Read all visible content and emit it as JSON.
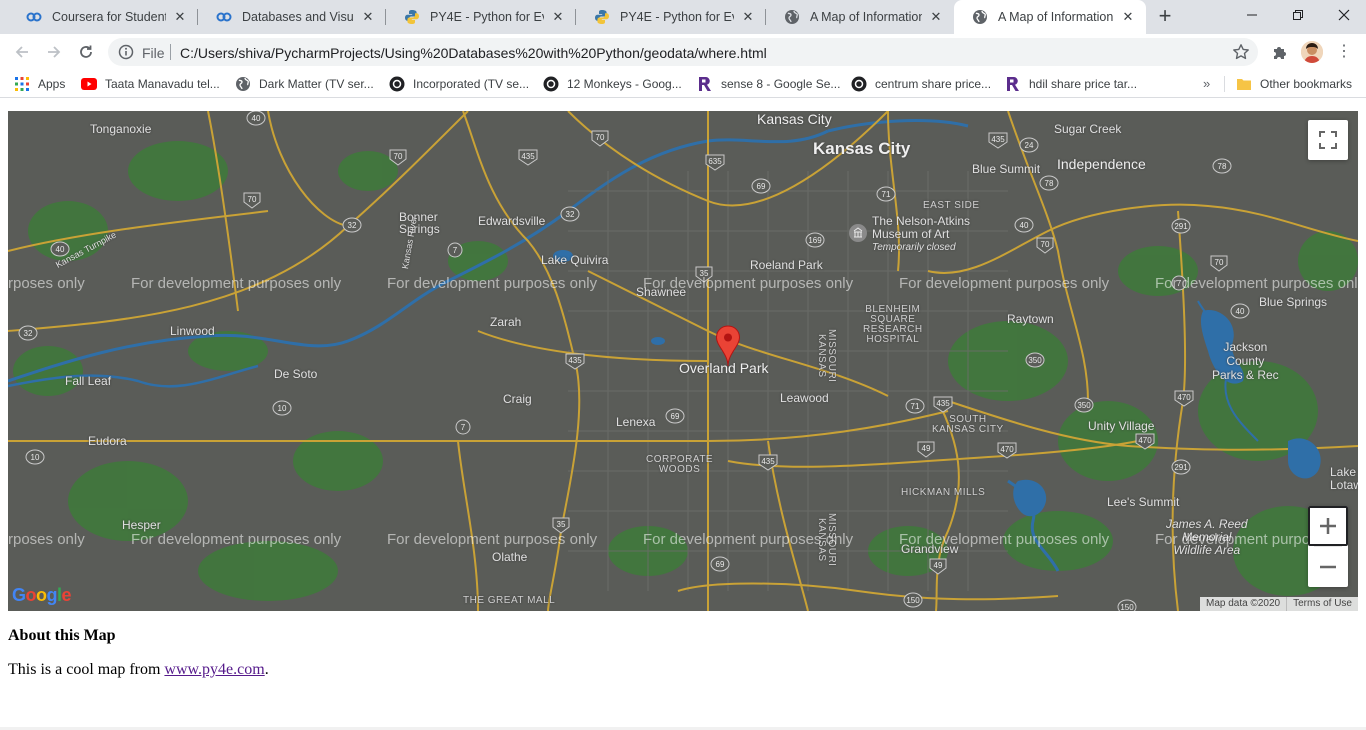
{
  "tabs": [
    {
      "title": "Coursera for Students |",
      "icon": "coursera-icon"
    },
    {
      "title": "Databases and Visualiza",
      "icon": "coursera-icon"
    },
    {
      "title": "PY4E - Python for Every",
      "icon": "python-icon"
    },
    {
      "title": "PY4E - Python for Every",
      "icon": "python-icon"
    },
    {
      "title": "A Map of Information",
      "icon": "globe-icon"
    },
    {
      "title": "A Map of Information",
      "icon": "globe-icon",
      "active": true
    }
  ],
  "toolbar": {
    "scheme_label": "File",
    "url": "C:/Users/shiva/PycharmProjects/Using%20Databases%20with%20Python/geodata/where.html"
  },
  "bookmarks": [
    {
      "label": "Apps",
      "icon": "apps-grid-icon"
    },
    {
      "label": "Taata Manavadu tel...",
      "icon": "youtube-icon"
    },
    {
      "label": "Dark Matter (TV ser...",
      "icon": "globe-icon"
    },
    {
      "label": "Incorporated (TV se...",
      "icon": "circle-logo-icon"
    },
    {
      "label": "12 Monkeys - Goog...",
      "icon": "circle-logo-icon"
    },
    {
      "label": "sense 8 - Google Se...",
      "icon": "r-logo-icon"
    },
    {
      "label": "centrum share price...",
      "icon": "circle-logo-icon"
    },
    {
      "label": "hdil share price tar...",
      "icon": "r-logo-icon"
    }
  ],
  "bookmarks_more": "»",
  "other_bookmarks": "Other bookmarks",
  "map": {
    "watermark": "For development purposes only",
    "watermark_clipped_left": "rposes only",
    "watermark_clipped_right": "For development purposes onl",
    "watermark_clipped_right_2": "For development purpo",
    "places": {
      "kansas_city": "Kansas City",
      "kansas_city_small": "Kansas City",
      "tonganoxie": "Tonganoxie",
      "sugar_creek": "Sugar Creek",
      "independence": "Independence",
      "blue_summit": "Blue Summit",
      "east_side": "EAST SIDE",
      "bonner_springs": "Bonner\nSprings",
      "edwardsville": "Edwardsville",
      "nelson_atkins": "The Nelson-Atkins\nMuseum of Art",
      "temporarily_closed": "Temporarily closed",
      "lake_quivira": "Lake Quivira",
      "roeland_park": "Roeland Park",
      "shawnee": "Shawnee",
      "blenheim": "BLENHEIM\nSQUARE\nRESEARCH\nHOSPITAL",
      "raytown": "Raytown",
      "blue_springs": "Blue Springs",
      "linwood": "Linwood",
      "zarah": "Zarah",
      "jackson_county": "Jackson\nCounty\nParks & Rec",
      "fall_leaf": "Fall Leaf",
      "de_soto": "De Soto",
      "overland_park": "Overland Park",
      "leawood": "Leawood",
      "craig": "Craig",
      "lenexa": "Lenexa",
      "south_kansas_city": "SOUTH\nKANSAS CITY",
      "unity_village": "Unity Village",
      "eudora": "Eudora",
      "corporate_woods": "CORPORATE\nWOODS",
      "hickman_mills": "HICKMAN MILLS",
      "lees_summit": "Lee's Summit",
      "hesper": "Hesper",
      "james_reed": "James A. Reed\nMemorial\nWildlife Area",
      "olathe": "Olathe",
      "grandview": "Grandview",
      "great_mall": "THE GREAT MALL",
      "lake_lotawana": "Lake\nLotaw",
      "kansas_turnpike": "Kansas Turnpike",
      "kansas_river": "Kansas River",
      "missouri_kansas": "MISSOURI\nKANSAS"
    },
    "attribution": "Map data ©2020",
    "terms": "Terms of Use",
    "google_logo": "Google"
  },
  "about": {
    "heading": "About this Map",
    "text_before": "This is a cool map from ",
    "link": "www.py4e.com",
    "text_after": "."
  }
}
